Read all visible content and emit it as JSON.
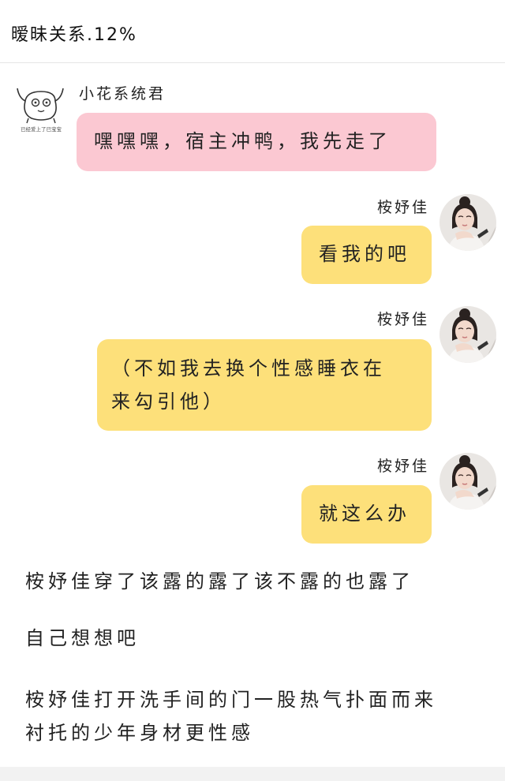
{
  "header": {
    "title": "暧昧关系.12%"
  },
  "messages": [
    {
      "sender": "小花系统君",
      "text": "嘿嘿嘿，宿主冲鸭，我先走了",
      "avatar_caption": "已经爱上了已宝宝"
    },
    {
      "sender": "桉妤佳",
      "text": "看我的吧"
    },
    {
      "sender": "桉妤佳",
      "text_line1": "（不如我去换个性感睡衣在",
      "text_line2": "来勾引他）"
    },
    {
      "sender": "桉妤佳",
      "text": "就这么办"
    }
  ],
  "story": {
    "line1": "桉妤佳穿了该露的露了该不露的也露了",
    "line2": "自己想想吧",
    "line3a": "桉妤佳打开洗手间的门一股热气扑面而来",
    "line3b": "衬托的少年身材更性感"
  },
  "colors": {
    "pink_bubble": "#fbc8d2",
    "yellow_bubble": "#fde07a",
    "header_border": "#e6e6e6"
  },
  "icons": {
    "system_avatar": "doodle-creature-icon",
    "user_avatar": "girl-portrait-avatar"
  }
}
